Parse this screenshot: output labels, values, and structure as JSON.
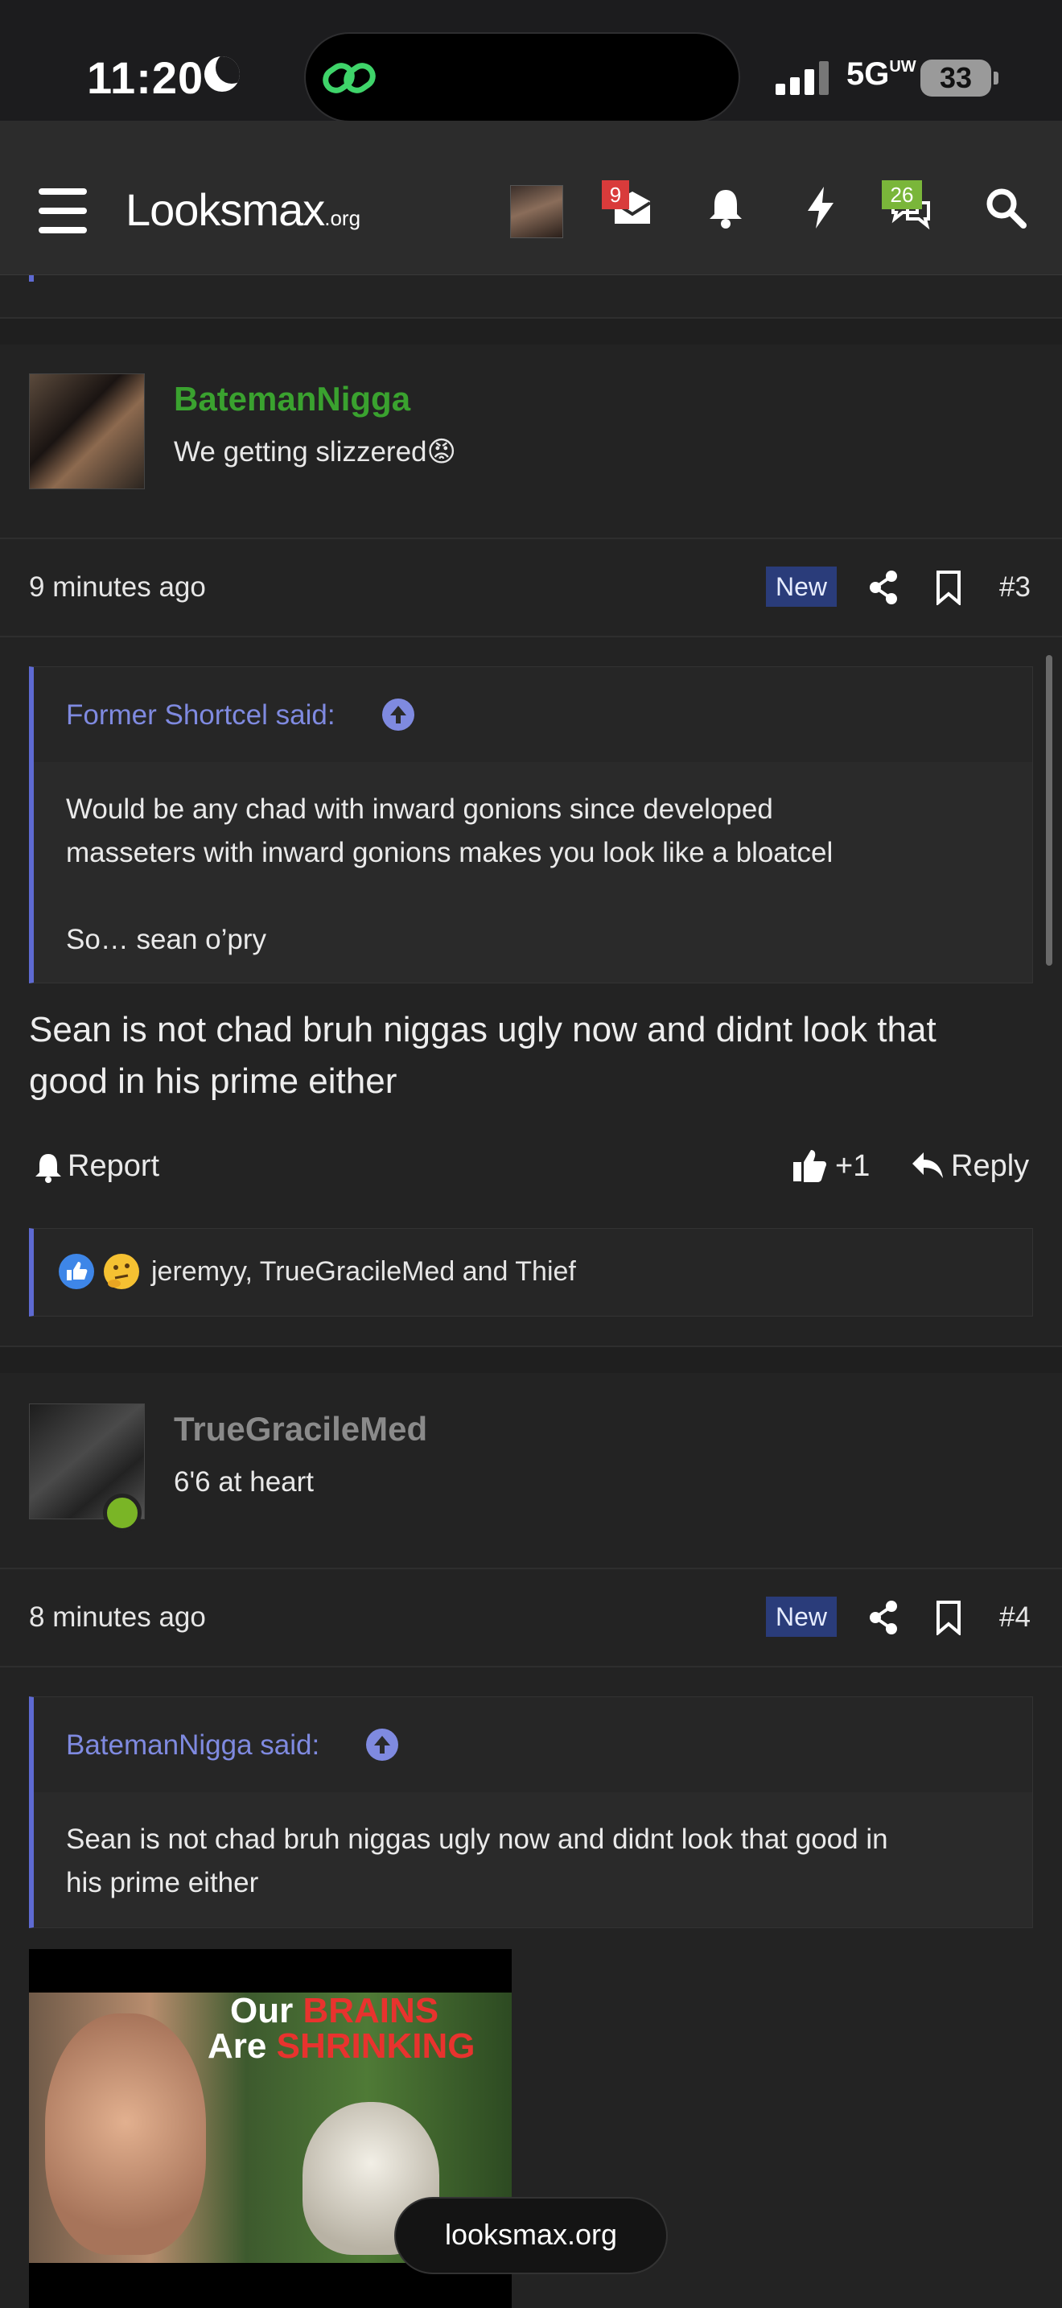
{
  "status_bar": {
    "time": "11:20",
    "network": "5G",
    "network_suffix": "UW",
    "battery": "33"
  },
  "header": {
    "logo_main": "Looksmax",
    "logo_suffix": ".org",
    "inbox_badge": "9",
    "chat_badge": "26"
  },
  "posts": [
    {
      "username": "BatemanNigga",
      "user_title": "We getting slizzered😡",
      "time": "9 minutes ago",
      "new_label": "New",
      "number": "#3",
      "quote_author": "Former Shortcel said:",
      "quote_lines": [
        "Would be any chad with inward gonions since developed",
        "masseters with inward gonions makes you look like a bloatcel",
        "So… sean o’pry"
      ],
      "text_lines": [
        "Sean is not chad bruh niggas ugly now and didnt look that",
        "good in his prime either"
      ],
      "report_label": "Report",
      "like_count": "+1",
      "reply_label": "Reply",
      "reactions_text": "jeremyy, TrueGracileMed and Thief"
    },
    {
      "username": "TrueGracileMed",
      "user_title": "6'6 at heart",
      "time": "8 minutes ago",
      "new_label": "New",
      "number": "#4",
      "quote_author": "BatemanNigga said:",
      "quote_lines": [
        "Sean is not chad bruh niggas ugly now and didnt look that good in",
        "his prime either"
      ],
      "image_text_line1_white": "Our",
      "image_text_line1_red": "BRAINS",
      "image_text_line2_white": "Are",
      "image_text_line2_red": "SHRINKING"
    }
  ],
  "footer_pill": "looksmax.org",
  "colors": {
    "accent": "#5e6ad2",
    "username_green": "#3aa22f",
    "badge_red": "#d93b3b",
    "badge_green": "#7ab63a",
    "online_dot": "#7ab526"
  }
}
